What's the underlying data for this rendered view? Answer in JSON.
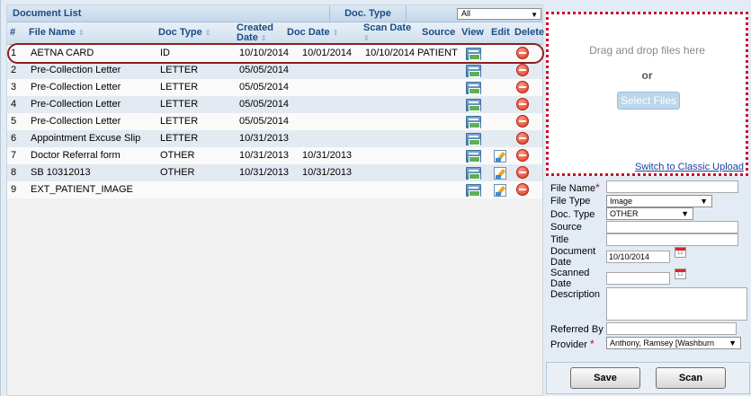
{
  "list": {
    "title": "Document List",
    "doctype_label": "Doc. Type",
    "doctype_filter": "All",
    "columns": {
      "num": "#",
      "file_name": "File Name",
      "doc_type": "Doc Type",
      "created": "Created Date",
      "doc_date": "Doc Date",
      "scan_date": "Scan Date",
      "source": "Source",
      "view": "View",
      "edit": "Edit",
      "delete": "Delete"
    },
    "rows": [
      {
        "num": "1",
        "file_name": "AETNA CARD",
        "doc_type": "ID",
        "created": "10/10/2014",
        "doc_date": "10/01/2014",
        "scan_date": "10/10/2014",
        "source": "PATIENT",
        "editable": false
      },
      {
        "num": "2",
        "file_name": "Pre-Collection Letter",
        "doc_type": "LETTER",
        "created": "05/05/2014",
        "doc_date": "",
        "scan_date": "",
        "source": "",
        "editable": false
      },
      {
        "num": "3",
        "file_name": "Pre-Collection Letter",
        "doc_type": "LETTER",
        "created": "05/05/2014",
        "doc_date": "",
        "scan_date": "",
        "source": "",
        "editable": false
      },
      {
        "num": "4",
        "file_name": "Pre-Collection Letter",
        "doc_type": "LETTER",
        "created": "05/05/2014",
        "doc_date": "",
        "scan_date": "",
        "source": "",
        "editable": false
      },
      {
        "num": "5",
        "file_name": "Pre-Collection Letter",
        "doc_type": "LETTER",
        "created": "05/05/2014",
        "doc_date": "",
        "scan_date": "",
        "source": "",
        "editable": false
      },
      {
        "num": "6",
        "file_name": "Appointment Excuse Slip",
        "doc_type": "LETTER",
        "created": "10/31/2013",
        "doc_date": "",
        "scan_date": "",
        "source": "",
        "editable": false
      },
      {
        "num": "7",
        "file_name": "Doctor Referral form",
        "doc_type": "OTHER",
        "created": "10/31/2013",
        "doc_date": "10/31/2013",
        "scan_date": "",
        "source": "",
        "editable": true
      },
      {
        "num": "8",
        "file_name": "SB 10312013",
        "doc_type": "OTHER",
        "created": "10/31/2013",
        "doc_date": "10/31/2013",
        "scan_date": "",
        "source": "",
        "editable": true
      },
      {
        "num": "9",
        "file_name": "EXT_PATIENT_IMAGE",
        "doc_type": "",
        "created": "",
        "doc_date": "",
        "scan_date": "",
        "source": "",
        "editable": true
      }
    ]
  },
  "upload": {
    "drop_text": "Drag and drop files here",
    "or_text": "or",
    "select_button": "Select Files",
    "classic_link": "Switch to Classic Upload"
  },
  "form": {
    "file_name_label": "File Name",
    "file_type_label": "File Type",
    "file_type_value": "Image",
    "doc_type_label": "Doc. Type",
    "doc_type_value": "OTHER",
    "source_label": "Source",
    "title_label": "Title",
    "document_date_label_1": "Document",
    "document_date_label_2": "Date",
    "document_date_value": "10/10/2014",
    "scanned_date_label_1": "Scanned",
    "scanned_date_label_2": "Date",
    "description_label": "Description",
    "referred_by_label": "Referred By",
    "provider_label": "Provider",
    "provider_value": "Anthony, Ramsey [Washburn",
    "save_button": "Save",
    "scan_button": "Scan"
  },
  "colors": {
    "accent_text": "#1c4c82",
    "highlight_ring": "#8c1f1f",
    "drop_border": "#c8102e",
    "required": "#d0001a"
  }
}
